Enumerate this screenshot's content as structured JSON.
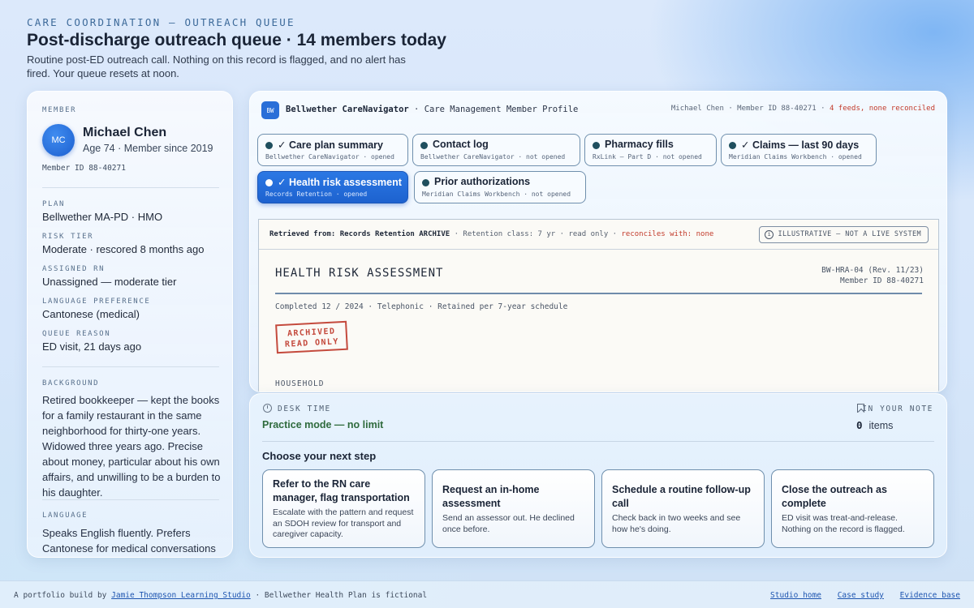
{
  "header": {
    "eyebrow": "CARE COORDINATION — OUTREACH QUEUE",
    "title": "Post-discharge outreach queue · 14 members today",
    "subtitle": "Routine post-ED outreach call. Nothing on this record is flagged, and no alert has fired. Your queue resets at noon."
  },
  "member": {
    "section_label": "MEMBER",
    "initials": "MC",
    "name": "Michael Chen",
    "age_line": "Age 74 · Member since 2019",
    "member_id": "Member ID 88-40271",
    "fields": [
      {
        "label": "PLAN",
        "value": "Bellwether MA-PD · HMO"
      },
      {
        "label": "RISK TIER",
        "value": "Moderate · rescored 8 months ago"
      },
      {
        "label": "ASSIGNED RN",
        "value": "Unassigned — moderate tier"
      },
      {
        "label": "LANGUAGE PREFERENCE",
        "value": "Cantonese (medical)"
      },
      {
        "label": "QUEUE REASON",
        "value": "ED visit, 21 days ago"
      }
    ],
    "background_label": "BACKGROUND",
    "background": "Retired bookkeeper — kept the books for a family restaurant in the same neighborhood for thirty-one years. Widowed three years ago. Precise about money, particular about his own affairs, and unwilling to be a burden to his daughter.",
    "language_label": "LANGUAGE",
    "language": "Speaks English fluently. Prefers Cantonese for medical conversations"
  },
  "system": {
    "logo": "BW",
    "name": "Bellwether CareNavigator",
    "context": "· Care Management Member Profile",
    "member_ref": "Michael Chen · Member ID 88-40271 ·",
    "feeds_status": "4 feeds, none reconciled",
    "tabs": [
      {
        "title": "✓ Care plan summary",
        "source": "Bellwether CareNavigator · opened"
      },
      {
        "title": "Contact log",
        "source": "Bellwether CareNavigator · not opened"
      },
      {
        "title": "Pharmacy fills",
        "source": "RxLink — Part D · not opened"
      },
      {
        "title": "✓ Claims — last 90 days",
        "source": "Meridian Claims Workbench · opened"
      },
      {
        "title": "✓ Health risk assessment",
        "source": "Records Retention · opened"
      },
      {
        "title": "Prior authorizations",
        "source": "Meridian Claims Workbench · not opened"
      }
    ]
  },
  "document": {
    "retrieved_prefix": "Retrieved from: Records Retention ARCHIVE",
    "retrieved_meta": " · Retention class: 7 yr · read only · ",
    "reconciles": "reconciles with: none",
    "illustrative": "ILLUSTRATIVE — NOT A LIVE SYSTEM",
    "illustrative_icon": "i",
    "title": "HEALTH RISK ASSESSMENT",
    "form_id": "BW-HRA-04 (Rev. 11/23)",
    "member_id": "Member ID 88-40271",
    "completed": "Completed 12 / 2024 · Telephonic · Retained per 7-year schedule",
    "stamp_line1": "ARCHIVED",
    "stamp_line2": "READ ONLY",
    "section_household": "HOUSEHOLD"
  },
  "decision": {
    "desk_time_label": "DESK TIME",
    "practice_mode": "Practice mode — no limit",
    "in_note_label": "IN YOUR NOTE",
    "item_count": "0",
    "items_label": "items",
    "choose_label": "Choose your next step",
    "options": [
      {
        "title": "Refer to the RN care manager, flag transportation",
        "desc": "Escalate with the pattern and request an SDOH review for transport and caregiver capacity."
      },
      {
        "title": "Request an in-home assessment",
        "desc": "Send an assessor out. He declined once before."
      },
      {
        "title": "Schedule a routine follow-up call",
        "desc": "Check back in two weeks and see how he's doing."
      },
      {
        "title": "Close the outreach as complete",
        "desc": "ED visit was treat-and-release. Nothing on the record is flagged."
      }
    ]
  },
  "footer": {
    "prefix": "A portfolio build by",
    "studio_link": "Jamie Thompson Learning Studio",
    "suffix": "· Bellwether Health Plan is fictional",
    "links": [
      "Studio home",
      "Case study",
      "Evidence base"
    ]
  },
  "colors": {
    "accent": "#1d62cf",
    "alert": "#c23a2a",
    "practice": "#2f6b3d"
  }
}
